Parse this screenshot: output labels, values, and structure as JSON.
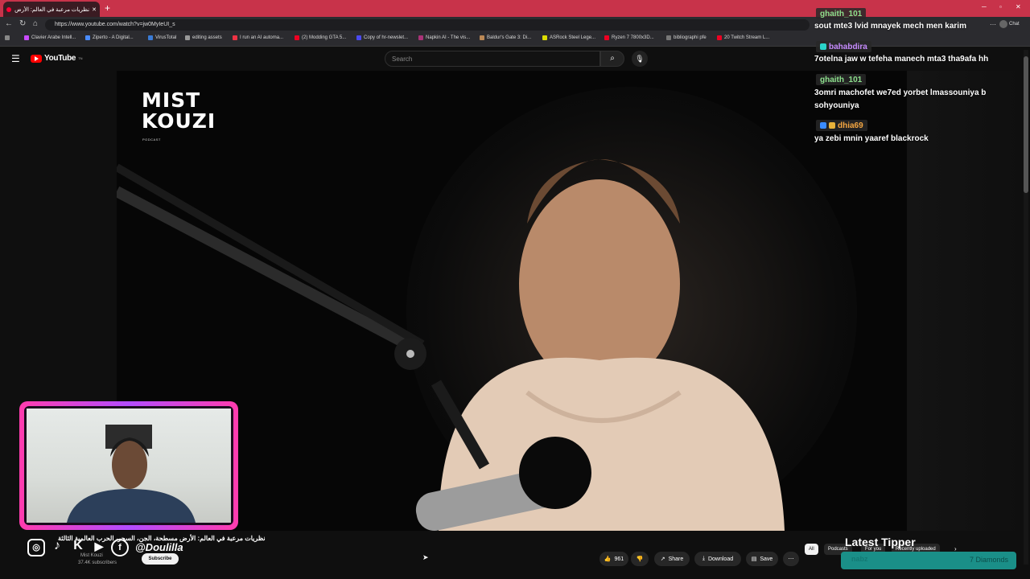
{
  "browser": {
    "tab_title": "نظريات مرعبة في العالم: الأرض",
    "url": "https://www.youtube.com/watch?v=jw0MyIeUI_s",
    "new_tab": "+",
    "bookmarks": [
      "Clavier Arabe Intell...",
      "Ziperto - A Digital...",
      "VirusTotal",
      "editing assets",
      "I run an AI automa...",
      "(2) Modding GTA 5...",
      "Copy of hr-newslet...",
      "Napkin AI - The vis...",
      "Baldur's Gate 3: Di...",
      "ASRock Steel Lege...",
      "Ryzen 7 7800x3D...",
      "bibliographi pfe",
      "20 Twitch Stream L..."
    ]
  },
  "youtube": {
    "logo": "YouTube",
    "logo_sup": "TN",
    "search_placeholder": "Search"
  },
  "video_overlay": {
    "show_logo_line1": "MIST",
    "show_logo_line2": "KOUZI",
    "show_logo_small": "PODCAST"
  },
  "stream_overlay": {
    "handle": "@Doulilla",
    "socials": [
      "instagram",
      "tiktok",
      "kick",
      "youtube",
      "facebook"
    ]
  },
  "video_info": {
    "title": "نظريات مرعبة في العالم: الأرض مسطحة، الجن، السحر، الحرب العالمية الثالثة",
    "channel": "Mist Kouzi",
    "subscribers": "37.4K subscribers",
    "subscribe_label": "Subscribe",
    "likes": "961",
    "share_label": "Share",
    "download_label": "Download",
    "save_label": "Save"
  },
  "chips": [
    "All",
    "Podcasts",
    "For you",
    "Recently uploaded"
  ],
  "tipper": {
    "heading": "Latest Tipper",
    "name": "nabz",
    "amount": "7 Diamonds"
  },
  "chat": {
    "label": "Chat",
    "messages": [
      {
        "user": "ghaith_101",
        "text": "sout mte3 lvid mnayek mech men karim",
        "color": "#8de08d"
      },
      {
        "user": "bahabdira",
        "text": "7otelna jaw w tefeha manech mta3 tha9afa hh",
        "color": "#c78cff"
      },
      {
        "user": "ghaith_101",
        "text": "3omri machofet we7ed yorbet lmassouniya b",
        "text2": "sohyouniya",
        "color": "#8de08d"
      },
      {
        "user": "dhia69",
        "text": "ya zebi mnin yaaref blackrock",
        "color": "#f5a742"
      }
    ]
  }
}
